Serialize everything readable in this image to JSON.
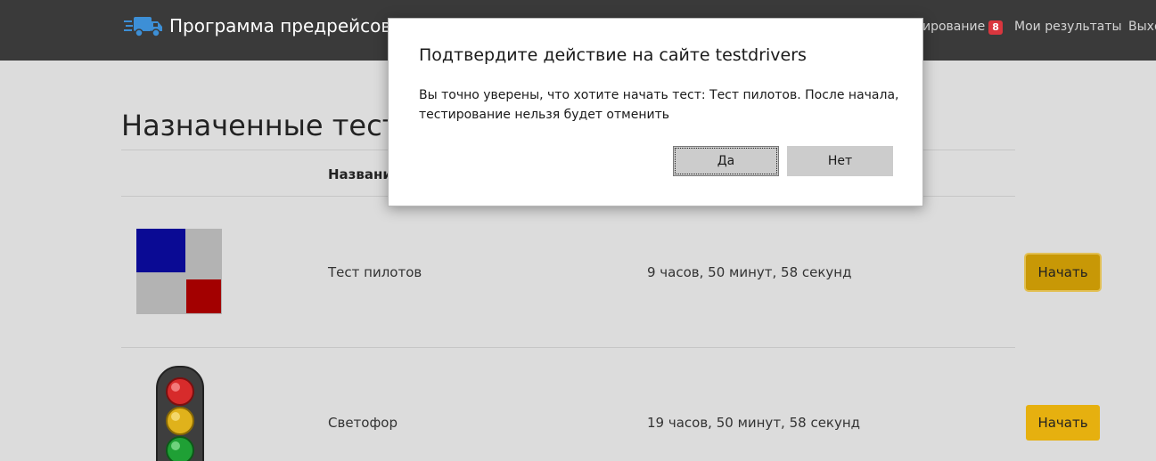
{
  "navbar": {
    "brand_title": "Программа предрейсового",
    "nav_testing_label": "ирование",
    "nav_testing_badge": "8",
    "nav_results_label": "Мои результаты",
    "nav_logout_label": "Выхо",
    "colors": {
      "background": "#3a3a3a",
      "badge": "#d9363e",
      "logo": "#3d8fd6"
    },
    "logo_icon": "truck-icon"
  },
  "main": {
    "heading": "Назначенные тести",
    "table": {
      "column_header_name": "Названи",
      "rows": [
        {
          "name": "Тест пилотов",
          "time": "9 часов, 50 минут, 58 секунд",
          "button": "Начать",
          "thumb": "quadrant-blocks-image"
        },
        {
          "name": "Светофор",
          "time": "19 часов, 50 минут, 58 секунд",
          "button": "Начать",
          "thumb": "traffic-light-image"
        }
      ]
    },
    "colors": {
      "accent_button": "#e6b00f",
      "accent_button_focused": "#c89806"
    }
  },
  "dialog": {
    "title": "Подтвердите действие на сайте testdrivers",
    "message": "Вы точно уверены, что хотите начать тест: Тест пилотов. После начала, тестирование нельзя будет отменить",
    "yes_label": "Да",
    "no_label": "Нет"
  }
}
